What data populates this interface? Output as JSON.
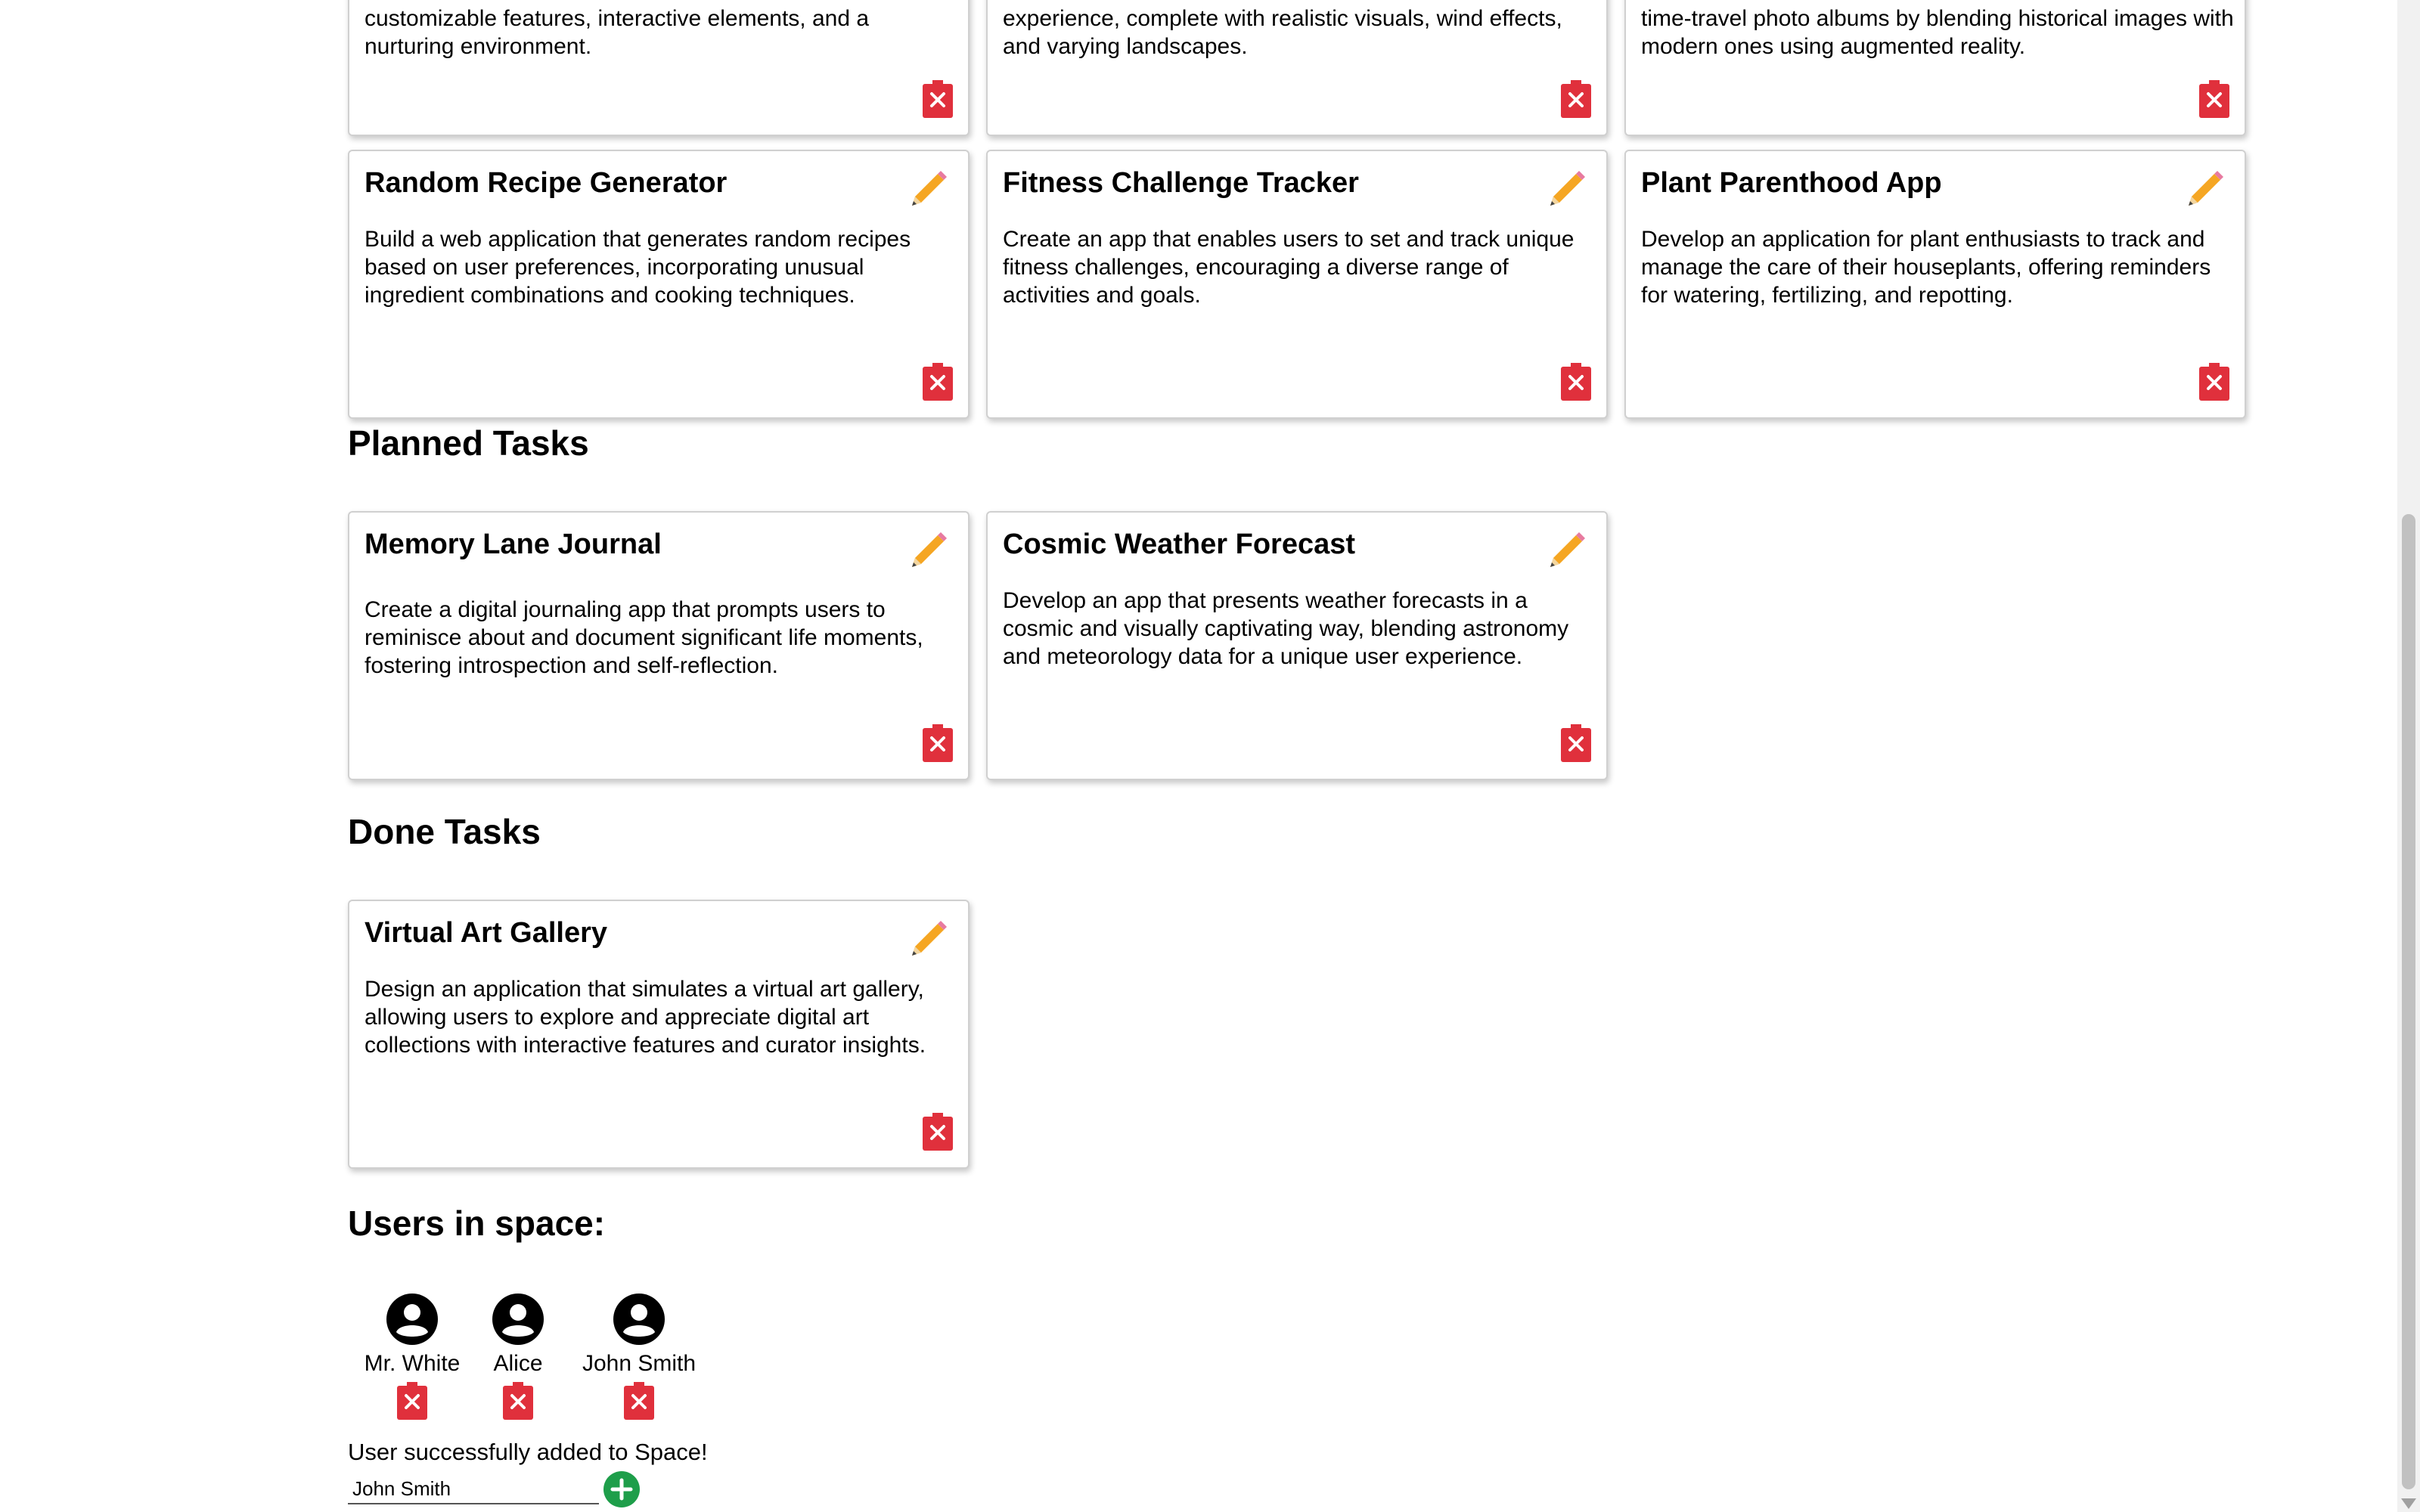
{
  "top_row": [
    {
      "desc": "customizable features, interactive elements, and a nurturing environment."
    },
    {
      "desc": "experience, complete with realistic visuals, wind effects, and varying landscapes."
    },
    {
      "desc": "time-travel photo albums by blending historical images with modern ones using augmented reality."
    }
  ],
  "second_row": [
    {
      "title": "Random Recipe Generator",
      "desc": "Build a web application that generates random recipes based on user preferences, incorporating unusual ingredient combinations and cooking techniques."
    },
    {
      "title": "Fitness Challenge Tracker",
      "desc": "Create an app that enables users to set and track unique fitness challenges, encouraging a diverse range of activities and goals."
    },
    {
      "title": "Plant Parenthood App",
      "desc": "Develop an application for plant enthusiasts to track and manage the care of their houseplants, offering reminders for watering, fertilizing, and repotting."
    }
  ],
  "planned": {
    "heading": "Planned Tasks",
    "cards": [
      {
        "title": "Memory Lane Journal",
        "desc": "Create a digital journaling app that prompts users to reminisce about and document significant life moments, fostering introspection and self-reflection."
      },
      {
        "title": "Cosmic Weather Forecast",
        "desc": "Develop an app that presents weather forecasts in a cosmic and visually captivating way, blending astronomy and meteorology data for a unique user experience."
      }
    ]
  },
  "done": {
    "heading": "Done Tasks",
    "cards": [
      {
        "title": "Virtual Art Gallery",
        "desc": "Design an application that simulates a virtual art gallery, allowing users to explore and appreciate digital art collections with interactive features and curator insights."
      }
    ]
  },
  "users": {
    "heading": "Users in space:",
    "list": [
      {
        "name": "Mr. White"
      },
      {
        "name": "Alice"
      },
      {
        "name": "John Smith"
      }
    ],
    "status_message": "User successfully added to Space!",
    "input_value": "John Smith"
  },
  "colors": {
    "delete_red": "#e0303c",
    "pencil_orange": "#f5a623",
    "add_green": "#1e9e4a"
  }
}
